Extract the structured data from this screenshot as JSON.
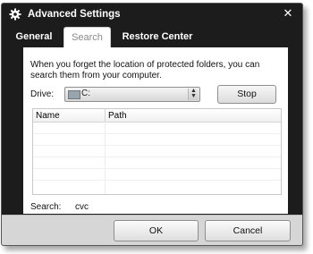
{
  "window": {
    "title": "Advanced Settings",
    "close_glyph": "✕"
  },
  "tabs": [
    {
      "label": "General",
      "active": false
    },
    {
      "label": "Search",
      "active": true
    },
    {
      "label": "Restore Center",
      "active": false
    }
  ],
  "search": {
    "description": "When you forget the location of protected folders, you can search them from your computer.",
    "drive_label": "Drive:",
    "drive_value": "C:",
    "stop_label": "Stop",
    "columns": [
      "Name",
      "Path"
    ],
    "status_label": "Search:",
    "status_value": "cvc"
  },
  "footer": {
    "ok_label": "OK",
    "cancel_label": "Cancel"
  },
  "icons": {
    "title_icon": "gear-icon",
    "close_icon": "close-icon",
    "drive_icon": "hard-drive-icon",
    "select_arrow": "spin-arrows-icon"
  },
  "colors": {
    "window_frame": "#1c1c1c",
    "footer": "#d6d6d6",
    "content": "#ffffff"
  }
}
